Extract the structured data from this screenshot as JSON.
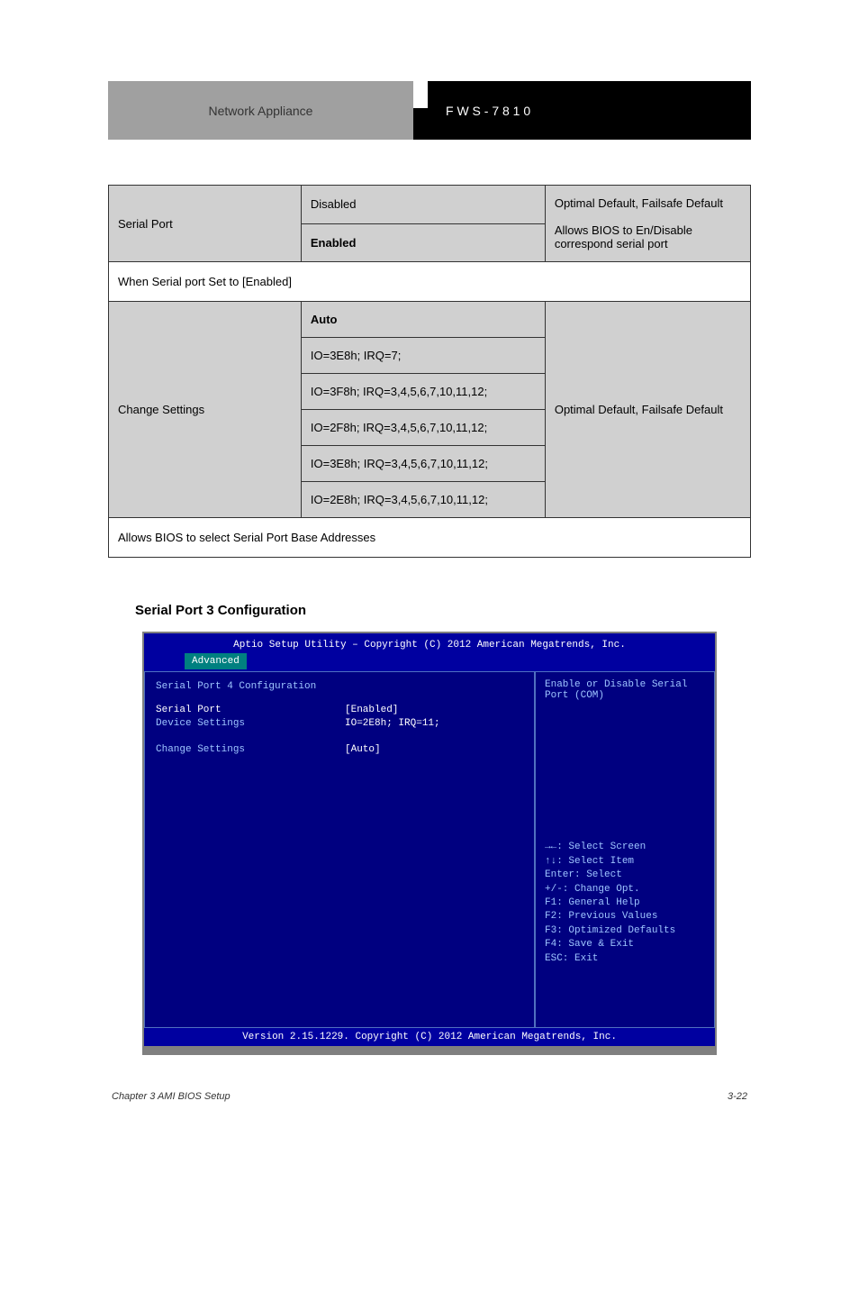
{
  "header": {
    "left": "Network Appliance",
    "right": "F W S - 7 8 1 0"
  },
  "table": {
    "row1": {
      "c1": "Serial Port",
      "c2a": "Disabled",
      "c2b": "Enabled",
      "c3top": "Optimal Default, Failsafe Default",
      "c3bottom": "Allows BIOS to En/Disable correspond serial port"
    },
    "divider": "When Serial port Set to [Enabled]",
    "row2": {
      "c1": "Change Settings",
      "options": [
        "Auto",
        "IO=3E8h; IRQ=7;",
        "IO=3F8h; IRQ=3,4,5,6,7,10,11,12;",
        "IO=2F8h; IRQ=3,4,5,6,7,10,11,12;",
        "IO=3E8h; IRQ=3,4,5,6,7,10,11,12;",
        "IO=2E8h; IRQ=3,4,5,6,7,10,11,12;"
      ],
      "c3top": "Optimal Default, Failsafe Default",
      "c3bottom": ""
    },
    "bottomDivider": "Allows BIOS to select Serial Port Base Addresses"
  },
  "biosTitle": "Serial Port 3 Configuration",
  "bios": {
    "copyrightTop": "Aptio Setup Utility – Copyright (C) 2012 American Megatrends, Inc.",
    "tab": "Advanced",
    "mainTitle": "Serial Port 4 Configuration",
    "settings": {
      "serialPortLabel": "Serial Port",
      "serialPortValue": "[Enabled]",
      "deviceSettingsLabel": "Device Settings",
      "deviceSettingsValue": "IO=2E8h; IRQ=11;",
      "changeSettingsLabel": "Change Settings",
      "changeSettingsValue": "[Auto]"
    },
    "helpTop": "Enable or Disable Serial Port (COM)",
    "keys": {
      "k1": "→←: Select Screen",
      "k2": "↑↓: Select Item",
      "k3": "Enter: Select",
      "k4": "+/-: Change Opt.",
      "k5": "F1: General Help",
      "k6": "F2: Previous Values",
      "k7": "F3: Optimized Defaults",
      "k8": "F4: Save & Exit",
      "k9": "ESC: Exit"
    },
    "copyrightBottom": "Version 2.15.1229. Copyright (C) 2012 American Megatrends, Inc."
  },
  "footer": {
    "left": "Chapter 3 AMI BIOS Setup",
    "right": "3-22"
  }
}
